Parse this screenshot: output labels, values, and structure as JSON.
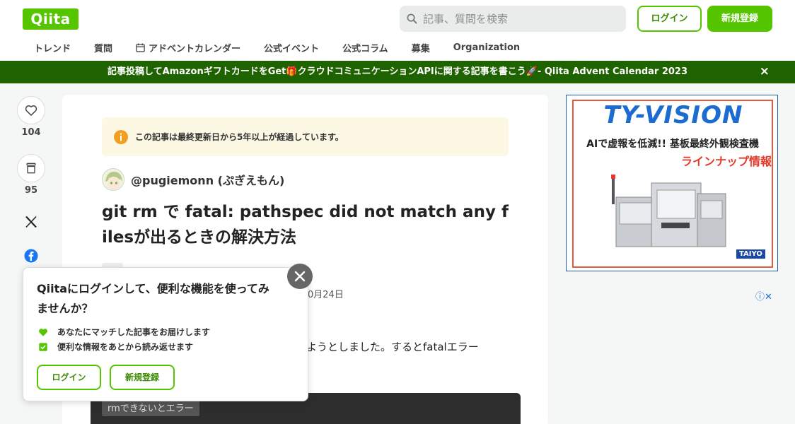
{
  "header": {
    "logo": "Qiita",
    "search_placeholder": "記事、質問を検索",
    "login_label": "ログイン",
    "signup_label": "新規登録"
  },
  "nav": {
    "items": [
      "トレンド",
      "質問",
      "アドベントカレンダー",
      "公式イベント",
      "公式コラム",
      "募集",
      "Organization"
    ]
  },
  "banner": {
    "text": "記事投稿してAmazonギフトカードをGet🎁クラウドコミュニケーションAPIに関する記事を書こう🚀- Qiita Advent Calendar 2023",
    "close": "×"
  },
  "actions": {
    "likes": "104",
    "stocks": "95"
  },
  "article": {
    "notice": "この記事は最終更新日から5年以上が経過しています。",
    "author": "@pugiemonn (ぷぎえもん)",
    "title": "git rm で fatal: pathspec did not match any filesが出るときの解決方法",
    "date_fragment": "0月24日",
    "body_fragment": "しようとしました。するとfatalエラー",
    "code_label": "rmできないとエラー"
  },
  "ad": {
    "logo": "TY-VISION",
    "line1": "AIで虚報を低減!! 基板最終外観検査機",
    "line2": "ラインナップ情報",
    "brand": "TAIYO",
    "info": "ⓘ✕"
  },
  "popup": {
    "title": "Qiitaにログインして、便利な機能を使ってみませんか？",
    "benefit1": "あなたにマッチした記事をお届けします",
    "benefit2": "便利な情報をあとから読み返せます",
    "login_label": "ログイン",
    "signup_label": "新規登録"
  },
  "colors": {
    "brand": "#55c500",
    "banner_bg": "#1f6200"
  }
}
